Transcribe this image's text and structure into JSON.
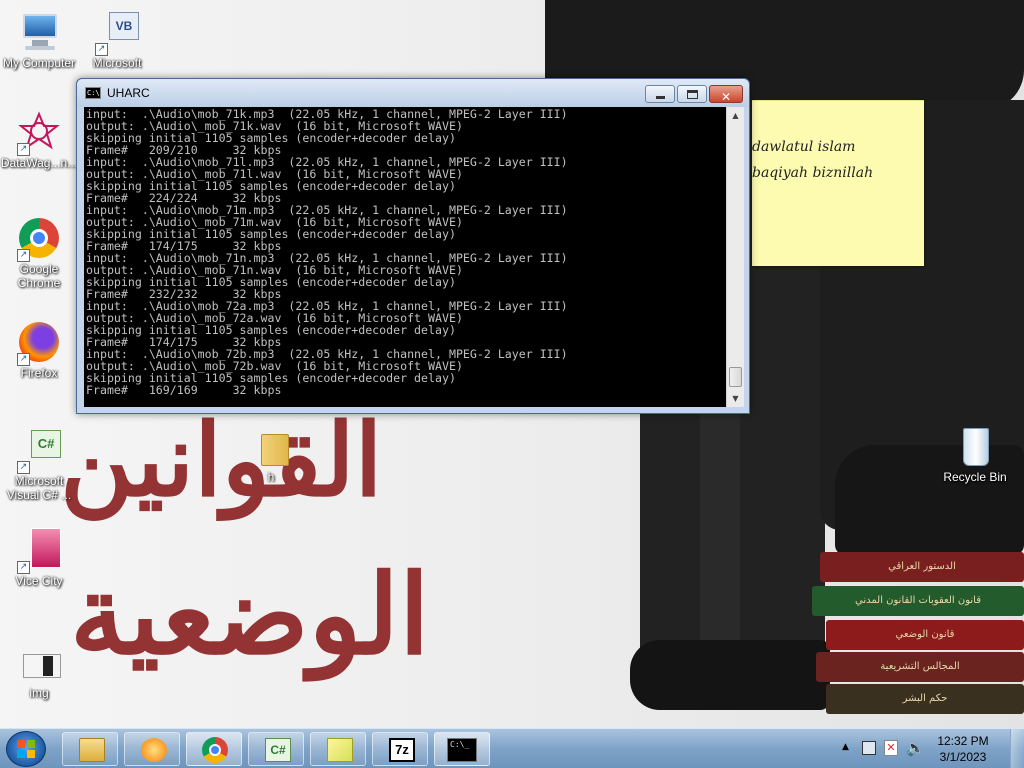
{
  "desktop": {
    "icons": [
      {
        "label": "My Computer"
      },
      {
        "label": "Microsoft"
      },
      {
        "label": "DataWag...n..."
      },
      {
        "label": "Google Chrome"
      },
      {
        "label": "Firefox"
      },
      {
        "label": "Microsoft Visual C# ..."
      },
      {
        "label": "h"
      },
      {
        "label": "Vice City"
      },
      {
        "label": "img"
      },
      {
        "label": "Recycle Bin"
      }
    ],
    "sticky_note": {
      "lines": [
        "dawlatul islam",
        "baqiyah biznillah"
      ]
    },
    "wallpaper": {
      "arabic_line1": "القوانين",
      "arabic_line2": "الوضعية",
      "books": [
        "الدستور العراقي",
        "قانون العقوبات القانون المدني",
        "قانون الوضعي",
        "المجالس التشريعية",
        "حكم البشر"
      ],
      "accent_color": "#8a1f1f"
    }
  },
  "console_window": {
    "title": "UHARC",
    "title_icon": "C:\\",
    "lines": [
      "input:  .\\Audio\\mob_71k.mp3  (22.05 kHz, 1 channel, MPEG-2 Layer III)",
      "output: .\\Audio\\_mob_71k.wav  (16 bit, Microsoft WAVE)",
      "skipping initial 1105 samples (encoder+decoder delay)",
      "Frame#   209/210     32 kbps",
      "input:  .\\Audio\\mob_71l.mp3  (22.05 kHz, 1 channel, MPEG-2 Layer III)",
      "output: .\\Audio\\_mob_71l.wav  (16 bit, Microsoft WAVE)",
      "skipping initial 1105 samples (encoder+decoder delay)",
      "Frame#   224/224     32 kbps",
      "input:  .\\Audio\\mob_71m.mp3  (22.05 kHz, 1 channel, MPEG-2 Layer III)",
      "output: .\\Audio\\_mob_71m.wav  (16 bit, Microsoft WAVE)",
      "skipping initial 1105 samples (encoder+decoder delay)",
      "Frame#   174/175     32 kbps",
      "input:  .\\Audio\\mob_71n.mp3  (22.05 kHz, 1 channel, MPEG-2 Layer III)",
      "output: .\\Audio\\_mob_71n.wav  (16 bit, Microsoft WAVE)",
      "skipping initial 1105 samples (encoder+decoder delay)",
      "Frame#   232/232     32 kbps",
      "input:  .\\Audio\\mob_72a.mp3  (22.05 kHz, 1 channel, MPEG-2 Layer III)",
      "output: .\\Audio\\_mob_72a.wav  (16 bit, Microsoft WAVE)",
      "skipping initial 1105 samples (encoder+decoder delay)",
      "Frame#   174/175     32 kbps",
      "input:  .\\Audio\\mob_72b.mp3  (22.05 kHz, 1 channel, MPEG-2 Layer III)",
      "output: .\\Audio\\_mob_72b.wav  (16 bit, Microsoft WAVE)",
      "skipping initial 1105 samples (encoder+decoder delay)",
      "Frame#   169/169     32 kbps"
    ]
  },
  "taskbar": {
    "buttons": [
      {
        "icon": "file-explorer-icon"
      },
      {
        "icon": "media-player-icon"
      },
      {
        "icon": "chrome-icon"
      },
      {
        "icon": "visual-csharp-icon",
        "glyph": "C#"
      },
      {
        "icon": "sticky-notes-icon"
      },
      {
        "icon": "7zip-icon",
        "glyph": "7z"
      },
      {
        "icon": "command-prompt-icon",
        "glyph": "C:\\_"
      }
    ],
    "clock": {
      "time": "12:32 PM",
      "date": "3/1/2023"
    }
  }
}
